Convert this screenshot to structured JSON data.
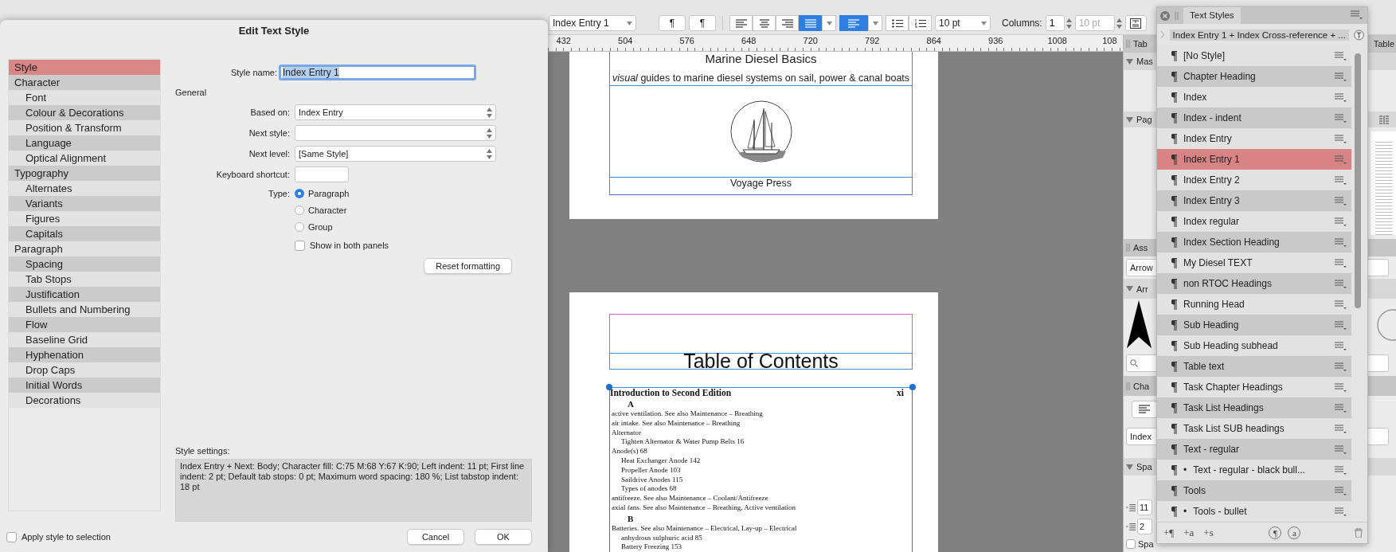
{
  "toolbar": {
    "style_dropdown": "Index Entry 1",
    "paragraph_buttons": [
      "¶",
      "¶"
    ],
    "alignment_buttons": [
      {
        "selected": false
      },
      {
        "selected": false
      },
      {
        "selected": false
      },
      {
        "selected": true
      }
    ],
    "vertical_alignment": {
      "selected": true
    },
    "font_size": "10 pt",
    "columns_label": "Columns:",
    "columns": "1",
    "gutter": {
      "value": "10 pt",
      "disabled": true
    }
  },
  "ruler": {
    "labels": [
      "432",
      "504",
      "576",
      "648",
      "720",
      "792",
      "864",
      "936",
      "1008",
      "108"
    ]
  },
  "document": {
    "cover": {
      "title": "Marine Diesel Basics",
      "tagline": "*visual* guides to marine diesel systems on sail, power & canal boats",
      "publisher": "Voyage Press"
    },
    "contents": {
      "heading": "Table of Contents",
      "toc_entry": {
        "title": "Introduction to Second Edition",
        "page": "xi"
      },
      "index_sections": [
        {
          "letter": "A",
          "entries": [
            {
              "text": "active ventilation. See also Maintenance – Breathing"
            },
            {
              "text": "air intake. See also Maintenance – Breathing"
            },
            {
              "text": "Alternator",
              "children": [
                {
                  "text": "Tighten Alternator & Water Pump Belts  16"
                }
              ]
            },
            {
              "text": "Anode(s)  68",
              "children": [
                {
                  "text": "Heat Exchanger Anode  142"
                },
                {
                  "text": "Propeller Anode  103"
                },
                {
                  "text": "Saildrive Anodes  115"
                },
                {
                  "text": "Types of anodes  68"
                }
              ]
            },
            {
              "text": "antifreeze. See also Maintenance – Coolant/Antifreeze"
            },
            {
              "text": "axial fans. See also Maintenance – Breathing, Active ventilation"
            }
          ]
        },
        {
          "letter": "B",
          "entries": [
            {
              "text": "Batteries. See also Maintenance – Electrical,  Lay-up  –  Electrical",
              "children": [
                {
                  "text": "anhydrous sulphuric acid  85"
                },
                {
                  "text": "Battery Freezing  153"
                }
              ]
            }
          ]
        }
      ]
    }
  },
  "dialog": {
    "title": "Edit Text Style",
    "categories": [
      {
        "label": "Style",
        "selected": true
      },
      {
        "label": "Character",
        "selected": false,
        "children": [
          {
            "label": "Font",
            "selected": false
          },
          {
            "label": "Colour & Decorations",
            "selected": false
          },
          {
            "label": "Position & Transform",
            "selected": false
          },
          {
            "label": "Language",
            "selected": false
          },
          {
            "label": "Optical Alignment",
            "selected": false
          }
        ]
      },
      {
        "label": "Typography",
        "selected": false,
        "children": [
          {
            "label": "Alternates",
            "selected": false
          },
          {
            "label": "Variants",
            "selected": false
          },
          {
            "label": "Figures",
            "selected": false
          },
          {
            "label": "Capitals",
            "selected": false
          }
        ]
      },
      {
        "label": "Paragraph",
        "selected": false,
        "children": [
          {
            "label": "Spacing",
            "selected": false
          },
          {
            "label": "Tab Stops",
            "selected": false
          },
          {
            "label": "Justification",
            "selected": false
          },
          {
            "label": "Bullets and Numbering",
            "selected": false
          },
          {
            "label": "Flow",
            "selected": false
          },
          {
            "label": "Baseline Grid",
            "selected": false
          },
          {
            "label": "Hyphenation",
            "selected": false
          },
          {
            "label": "Drop Caps",
            "selected": false
          },
          {
            "label": "Initial Words",
            "selected": false
          },
          {
            "label": "Decorations",
            "selected": false
          }
        ]
      }
    ],
    "style_name": {
      "label": "Style name:",
      "value": "Index Entry 1"
    },
    "section": "General",
    "based_on": {
      "label": "Based on:",
      "value": "Index Entry"
    },
    "next_style": {
      "label": "Next style:"
    },
    "next_level": {
      "label": "Next level:",
      "value": "[Same Style]"
    },
    "keyboard_shortcut": {
      "label": "Keyboard shortcut:"
    },
    "type": {
      "label": "Type:",
      "options": [
        {
          "label": "Paragraph",
          "selected": true
        },
        {
          "label": "Character",
          "selected": false
        },
        {
          "label": "Group",
          "selected": false
        }
      ]
    },
    "show_in_both_panels": {
      "label": "Show in both panels",
      "checked": false
    },
    "reset_button": "Reset formatting",
    "style_settings": {
      "label": "Style settings:",
      "text": "Index Entry + Next: Body; Character fill: C:75 M:68 Y:67 K:90; Left indent: 11 pt; First line indent: 2 pt; Default tab stops: 0 pt; Maximum word spacing: 180 %; List tabstop indent: 18 pt"
    },
    "apply_style": {
      "label": "Apply style to selection",
      "checked": false
    },
    "buttons": [
      "Cancel",
      "OK"
    ]
  },
  "text_styles": {
    "title": "Text Styles",
    "breadcrumb": "Index Entry 1 + Index Cross-reference + ...",
    "styles": [
      {
        "name": "[No Style]",
        "selected": false
      },
      {
        "name": "Chapter Heading",
        "selected": false
      },
      {
        "name": "Index",
        "selected": false
      },
      {
        "name": "Index - indent",
        "selected": false
      },
      {
        "name": "Index Entry",
        "selected": false
      },
      {
        "name": "Index Entry 1",
        "selected": true
      },
      {
        "name": "Index Entry 2",
        "selected": false
      },
      {
        "name": "Index Entry 3",
        "selected": false
      },
      {
        "name": "Index regular",
        "selected": false
      },
      {
        "name": "Index Section Heading",
        "selected": false
      },
      {
        "name": "My Diesel TEXT",
        "selected": false
      },
      {
        "name": "non RTOC Headings",
        "selected": false
      },
      {
        "name": "Running Head",
        "selected": false
      },
      {
        "name": "Sub Heading",
        "selected": false
      },
      {
        "name": "Sub Heading subhead",
        "selected": false
      },
      {
        "name": "Table text",
        "selected": false
      },
      {
        "name": "Task Chapter Headings",
        "selected": false
      },
      {
        "name": "Task List Headings",
        "selected": false
      },
      {
        "name": "Task List SUB headings",
        "selected": false
      },
      {
        "name": "Text - regular",
        "selected": false
      },
      {
        "name": "Text - regular - black bull...",
        "bullet": "•",
        "selected": false
      },
      {
        "name": "Tools",
        "selected": false
      },
      {
        "name": "Tools - bullet",
        "bullet": "•",
        "selected": false
      }
    ],
    "footer_buttons": [
      "+¶",
      "+a",
      "+s"
    ],
    "footer_circle_buttons": [
      "¶",
      "a"
    ]
  },
  "side_panel": {
    "rows": [
      {
        "kind": "header",
        "label": "Tab",
        "right_label": "Table"
      },
      {
        "kind": "section",
        "label": "Mas"
      },
      {
        "kind": "section",
        "label": "Pag"
      },
      {
        "kind": "thumbnail"
      },
      {
        "kind": "header",
        "label": "Ass"
      },
      {
        "kind": "field",
        "value": "Arrow"
      },
      {
        "kind": "section",
        "label": "Arr"
      },
      {
        "kind": "shapes"
      },
      {
        "kind": "search"
      },
      {
        "kind": "header",
        "label": "Cha"
      },
      {
        "kind": "align"
      },
      {
        "kind": "field",
        "value": "Index"
      },
      {
        "kind": "section",
        "label": "Spa"
      },
      {
        "kind": "spin",
        "value": "11"
      },
      {
        "kind": "spin",
        "value": "2"
      },
      {
        "kind": "checkbox",
        "label": "Spa",
        "checked": false
      }
    ]
  }
}
